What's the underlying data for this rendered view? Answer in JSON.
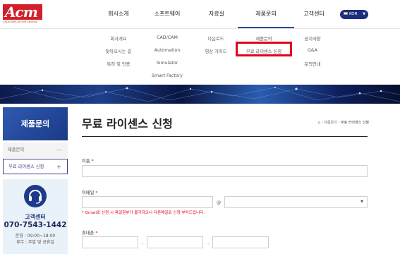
{
  "logo": {
    "mark": "Acm",
    "sub": "CAD/CAM/CAE/CIM Solution"
  },
  "gnb": [
    {
      "label": "회사소개"
    },
    {
      "label": "소프트웨어"
    },
    {
      "label": "자료실"
    },
    {
      "label": "제품문의",
      "active": true
    },
    {
      "label": "고객센터"
    }
  ],
  "lang": {
    "label": "KOR"
  },
  "submenu": {
    "company": [
      "회사개요",
      "찾아오시는 길",
      "특허 및 인증"
    ],
    "software": [
      "CAD/CAM",
      "Automation",
      "Simulator",
      "Smart Factory"
    ],
    "resources": [
      "다운로드",
      "영상 가이드"
    ],
    "inquiry": [
      "제품문의",
      "무료 라이센스 신청"
    ],
    "support": [
      "공지사항",
      "Q&A",
      "문의안내"
    ]
  },
  "side": {
    "title": "제품문의",
    "items": [
      {
        "label": "제품문의",
        "sign": "—"
      },
      {
        "label": "무료 라이센스 신청",
        "sign": "+"
      }
    ],
    "cs": {
      "title": "고객센터",
      "phone": "070-7543-1442",
      "hours": "운영 : 09:00~18:00",
      "off": "휴무 : 주말 및 공휴일"
    }
  },
  "main": {
    "title": "무료 라이센스 신청",
    "breadcrumb": {
      "sep": "›",
      "parent": "제품문의",
      "current": "무료 라이센스 신청"
    },
    "form": {
      "name_label": "이름",
      "email_label": "이메일",
      "email_at": "@",
      "email_notice": "* Gmail로 신청 시 파일첨부가 불가하오니 다른메일로 신청 부탁드립니다.",
      "phone_label": "휴대폰",
      "required_mark": "*",
      "phone_dash": "-"
    }
  },
  "colors": {
    "brand_red": "#d21f29",
    "navy": "#1c2f7e",
    "highlight": "#e3001b",
    "side_blue": "#234b9e"
  }
}
